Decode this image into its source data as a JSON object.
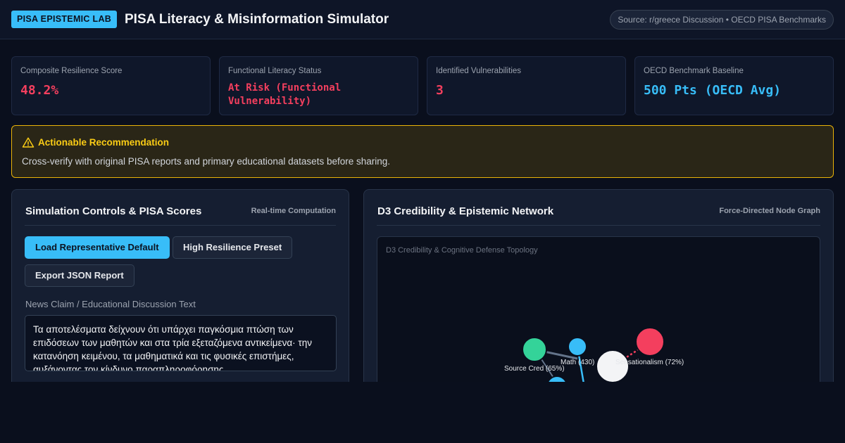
{
  "header": {
    "badge": "PISA EPISTEMIC LAB",
    "title": "PISA Literacy & Misinformation Simulator",
    "source": "Source: r/greece Discussion • OECD PISA Benchmarks"
  },
  "stats": [
    {
      "label": "Composite Resilience Score",
      "value": "48.2%"
    },
    {
      "label": "Functional Literacy Status",
      "value": "At Risk (Functional Vulnerability)"
    },
    {
      "label": "Identified Vulnerabilities",
      "value": "3"
    },
    {
      "label": "OECD Benchmark Baseline",
      "value": "500 Pts (OECD Avg)"
    }
  ],
  "recommendation": {
    "icon": "warning-triangle-icon",
    "title": "Actionable Recommendation",
    "body": "Cross-verify with original PISA reports and primary educational datasets before sharing."
  },
  "controls": {
    "title": "Simulation Controls & PISA Scores",
    "tag": "Real-time Computation",
    "buttons": {
      "load_default": "Load Representative Default",
      "high_resilience": "High Resilience Preset",
      "export_json": "Export JSON Report"
    },
    "field_label": "News Claim / Educational Discussion Text",
    "field_value": "Τα αποτελέσματα δείχνουν ότι υπάρχει παγκόσμια πτώση των επιδόσεων των μαθητών και στα τρία εξεταζόμενα αντικείμενα· την κατανόηση κειμένου, τα μαθηματικά και τις φυσικές επιστήμες, αυξάνοντας τον κίνδυνο παραπληροφόρησης."
  },
  "network": {
    "title": "D3 Credibility & Epistemic Network",
    "tag": "Force-Directed Node Graph",
    "graph_title": "D3 Credibility & Cognitive Defense Topology",
    "nodes": [
      {
        "id": "source",
        "label": "Source Cred (65%)",
        "color": "#34d399"
      },
      {
        "id": "math",
        "label": "Math (430)",
        "color": "#38bdf8"
      },
      {
        "id": "sensationalism",
        "label": "Sensationalism (72%)",
        "color": "#f43f5e"
      },
      {
        "id": "core",
        "label": "",
        "color": "#f3f4f6"
      },
      {
        "id": "reading",
        "label": "",
        "color": "#38bdf8"
      }
    ],
    "colors": {
      "link": "#64748b",
      "link_accent": "#38bdf8",
      "link_risk": "#f43f5e"
    }
  }
}
